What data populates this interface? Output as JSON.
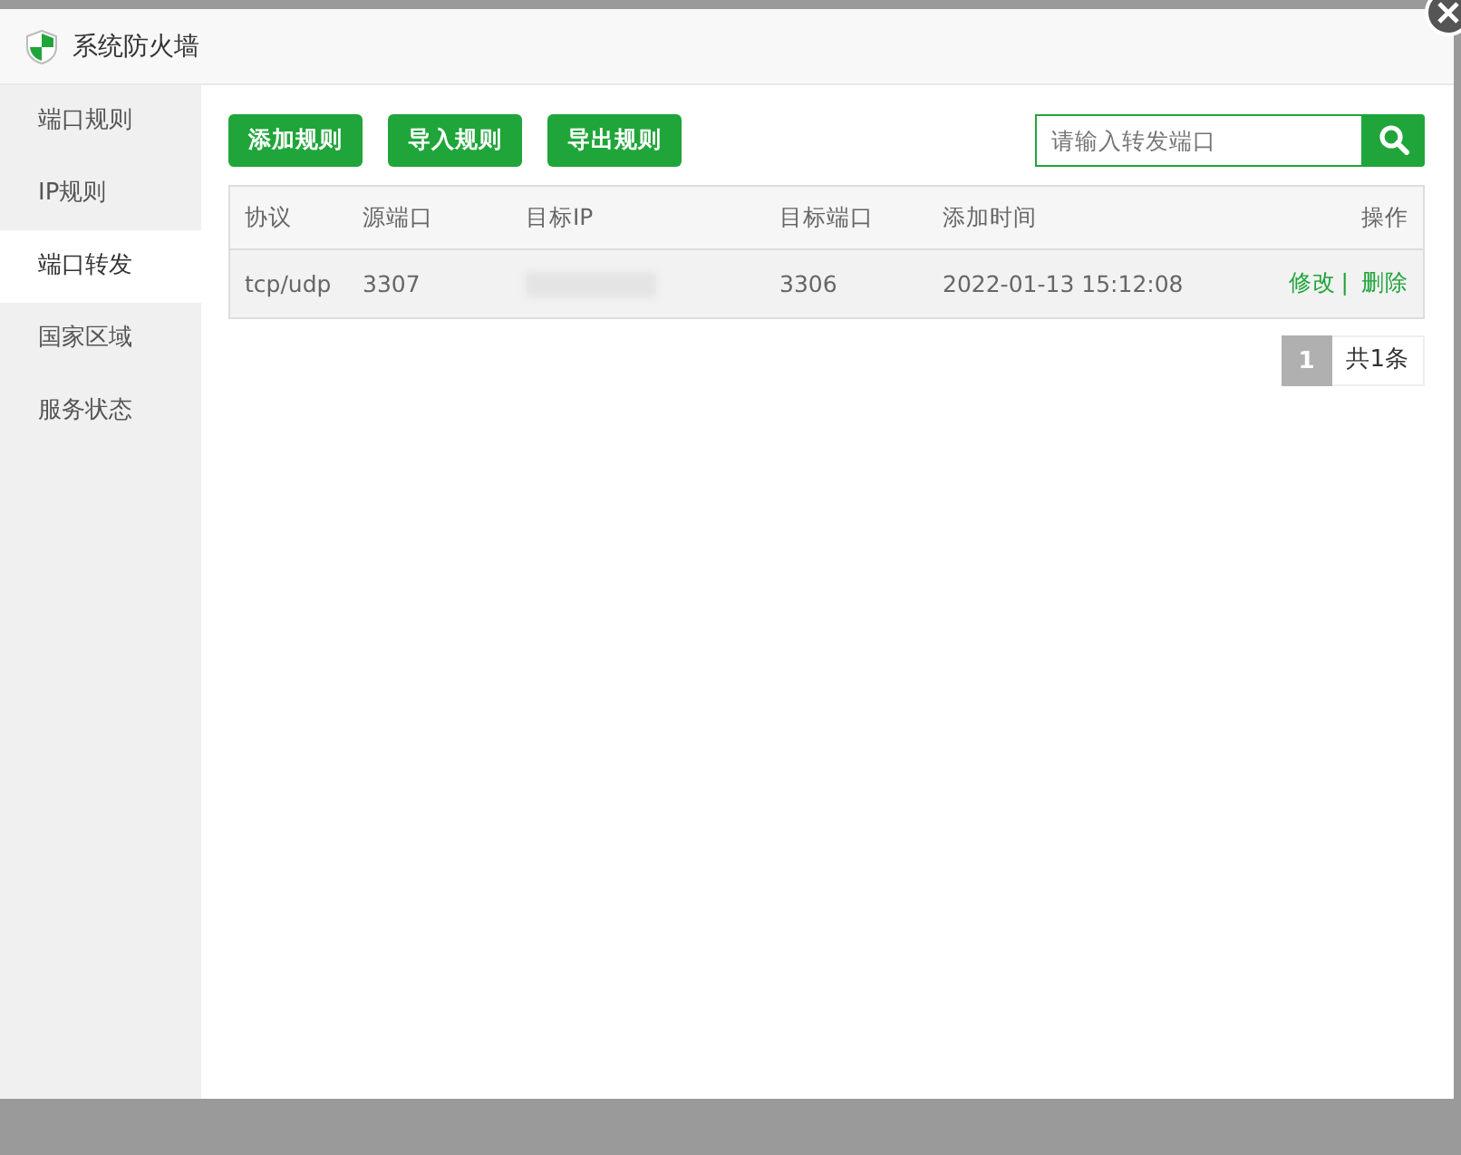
{
  "window": {
    "title": "系统防火墙"
  },
  "sidebar": {
    "items": [
      {
        "label": "端口规则",
        "selected": false
      },
      {
        "label": "IP规则",
        "selected": false
      },
      {
        "label": "端口转发",
        "selected": true
      },
      {
        "label": "国家区域",
        "selected": false
      },
      {
        "label": "服务状态",
        "selected": false
      }
    ]
  },
  "toolbar": {
    "buttons": [
      "添加规则",
      "导入规则",
      "导出规则"
    ]
  },
  "search": {
    "placeholder": "请输入转发端口"
  },
  "table": {
    "columns": [
      "协议",
      "源端口",
      "目标IP",
      "目标端口",
      "添加时间",
      "操作"
    ],
    "rows": [
      {
        "protocol": "tcp/udp",
        "source_port": "3307",
        "target_ip_redacted": true,
        "target_port": "3306",
        "added": "2022-01-13 15:12:08",
        "actions": [
          "修改",
          "删除"
        ],
        "separator": "|"
      }
    ]
  },
  "pagination": {
    "pages": [
      {
        "label": "1",
        "selected": true
      }
    ],
    "total": "共1条"
  }
}
